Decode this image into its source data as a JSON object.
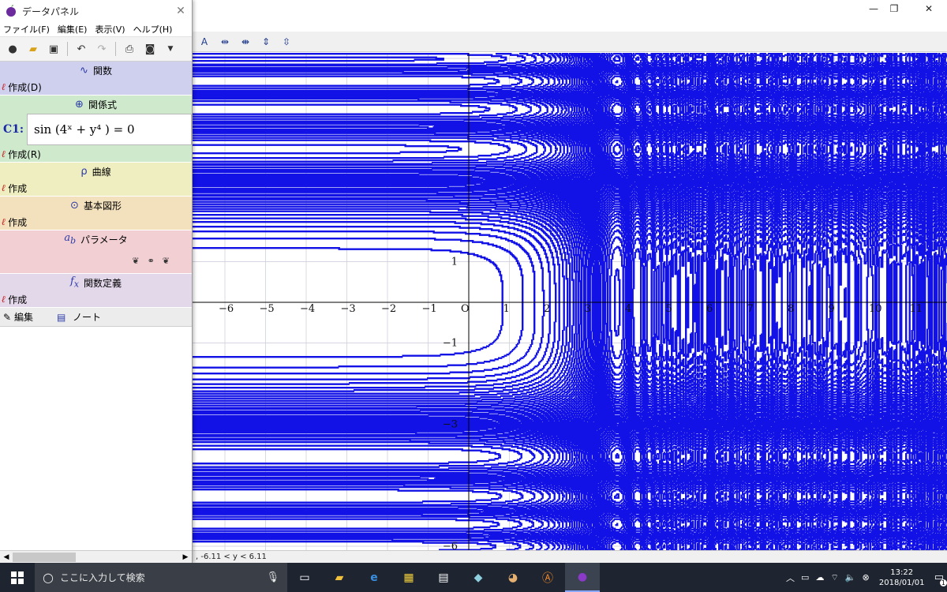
{
  "panel": {
    "title": "データパネル",
    "menu": [
      "ファイル(F)",
      "編集(E)",
      "表示(V)",
      "ヘルプ(H)"
    ],
    "sections": {
      "function": {
        "title": "関数",
        "create": "作成(D)"
      },
      "relation": {
        "title": "関係式",
        "equation_label": "C1:",
        "equation_text": "sin (4ˣ + y⁴ ) = 0",
        "create": "作成(R)"
      },
      "curve": {
        "title": "曲線",
        "create": "作成"
      },
      "basic_shape": {
        "title": "基本図形",
        "create": "作成"
      },
      "parameter": {
        "title": "パラメータ"
      },
      "function_def": {
        "title": "関数定義",
        "create": "作成"
      },
      "edit": {
        "label": "編集",
        "note": "ノート"
      }
    }
  },
  "graph": {
    "x_tick_labels": [
      "−6",
      "−5",
      "−4",
      "−3",
      "−2",
      "−1",
      "O",
      "1",
      "2",
      "3",
      "4",
      "5",
      "6",
      "7",
      "8",
      "9",
      "10",
      "11"
    ],
    "y_tick_labels": [
      "1",
      "−1",
      "−3",
      "−6"
    ],
    "curve_color": "#1212e6",
    "grid_color": "#c9c9d8"
  },
  "statusbar": {
    "text": ", -6.11 < y <  6.11"
  },
  "taskbar": {
    "search_placeholder": "ここに入力して検索",
    "time": "13:22",
    "date": "2018/01/01",
    "notification_count": "1"
  }
}
